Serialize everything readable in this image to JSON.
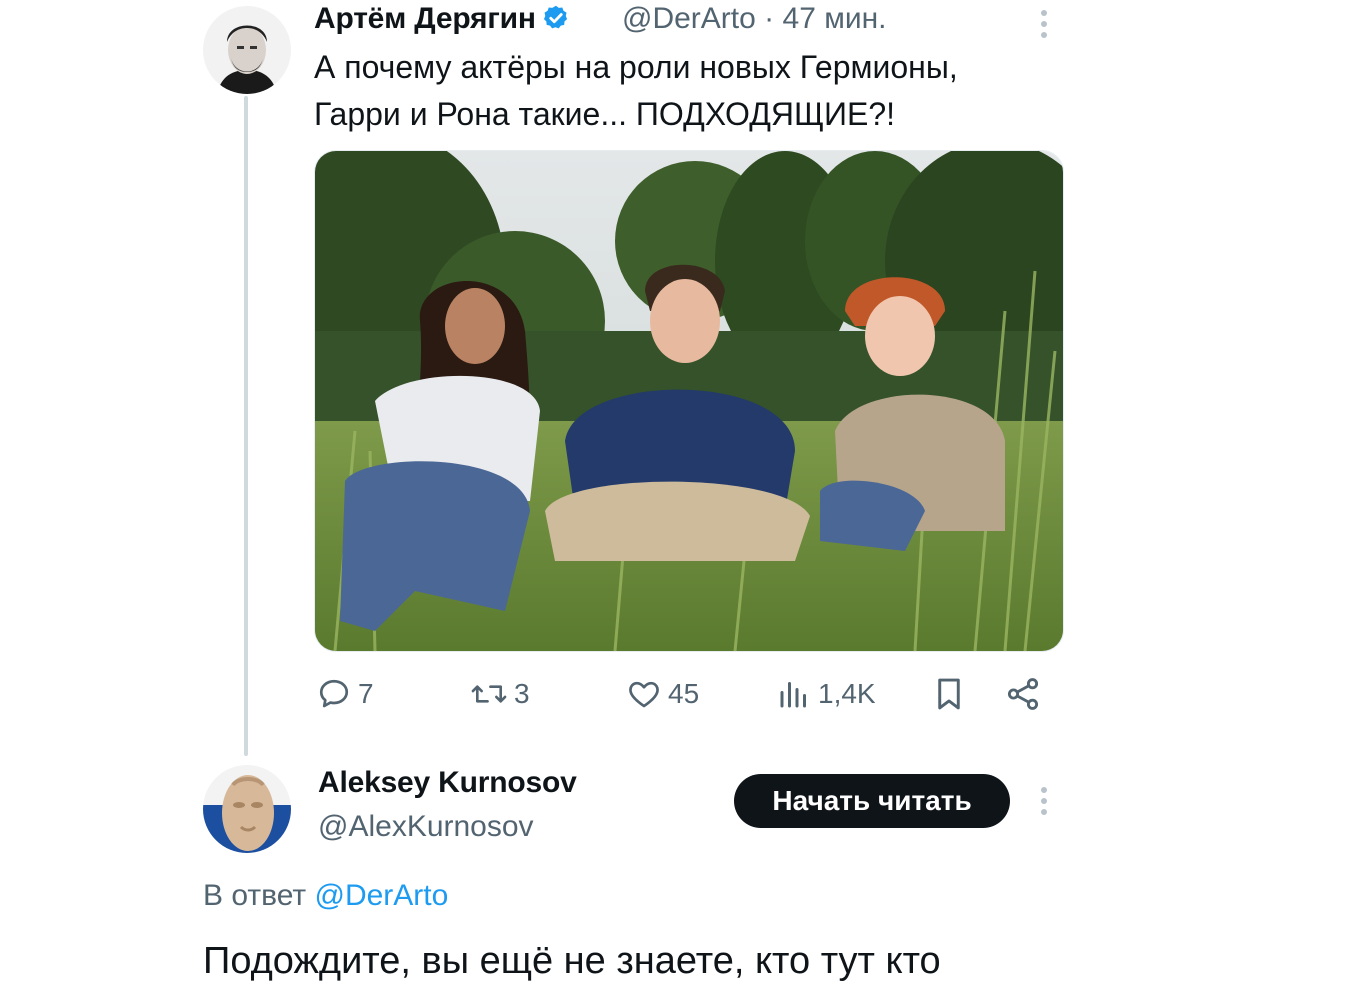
{
  "tweet": {
    "author_name": "Артём Дерягин",
    "handle": "@DerArto",
    "separator": "·",
    "time": "47 мин.",
    "text_line1": "А почему актёры на роли новых Гермионы,",
    "text_line2": "Гарри и Рона такие... ПОДХОДЯЩИЕ?!",
    "media_icon": "photo-three-kids-in-grass",
    "actions": {
      "replies": "7",
      "retweets": "3",
      "likes": "45",
      "views": "1,4K"
    }
  },
  "reply": {
    "author_name": "Aleksey Kurnosov",
    "handle": "@AlexKurnosov",
    "follow_label": "Начать читать",
    "reply_prefix": "В ответ",
    "reply_to_handle": "@DerArto",
    "text": "Подождите, вы ещё не знаете, кто тут кто"
  },
  "colors": {
    "accent": "#1d9bf0",
    "muted": "#536471",
    "button_bg": "#0f1419"
  }
}
